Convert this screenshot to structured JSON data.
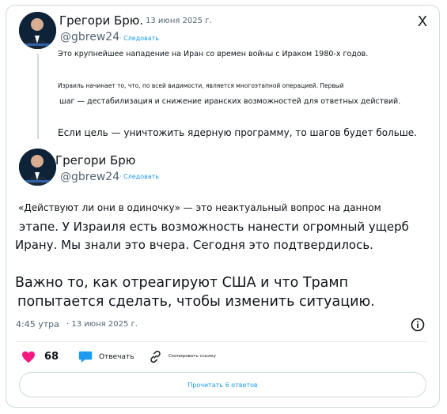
{
  "close_icon_text": "X",
  "main_post": {
    "author_name": "Грегори Брю.",
    "date": "13 июня 2025 г.",
    "handle": "@gbrew24",
    "follow_label": "· Следовать",
    "line1": "Это крупнейшее нападение на Иран со времен войны с Ираком 1980-х годов.",
    "line2": "Израиль начинает то, что, по всей видимости, является многоэтапной операцией. Первый",
    "line3": "шаг — дестабилизация и снижение иранских возможностей для ответных действий.",
    "line4": "Если цель — уничтожить ядерную программу, то шагов будет больше."
  },
  "reply_post": {
    "author_name": "Грегори Брю",
    "handle": "@gbrew24",
    "follow_label": "· Следовать",
    "line1": "«Действуют ли они в одиночку» — это неактуальный вопрос на данном",
    "line2": "этапе. У Израиля есть возможность нанести огромный ущерб",
    "line3": "Ирану. Мы знали это вчера. Сегодня это подтвердилось.",
    "line4": "Важно то, как отреагируют США и что Трамп",
    "line5": "попытается сделать, чтобы изменить ситуацию.",
    "time": "4:45 утра",
    "date": "· 13 июня 2025 г."
  },
  "actions": {
    "like_count": "68",
    "reply_label": "Отвечать",
    "copy_link_label": "Скопировать ссылку"
  },
  "read_replies_label": "Прочитать 6 ответов",
  "colors": {
    "like": "#f91880",
    "accent": "#1d9bf0",
    "text": "#0f1419",
    "muted": "#536471"
  }
}
